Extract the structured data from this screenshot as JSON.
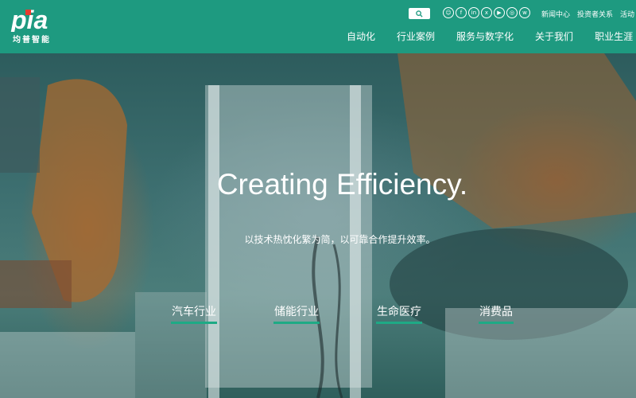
{
  "brand": {
    "logo_text": "pia",
    "logo_sub": "均普智能",
    "accent_color": "#1e9a80"
  },
  "search": {
    "icon": "search-icon"
  },
  "social_links": [
    {
      "name": "wechat",
      "glyph": "☺"
    },
    {
      "name": "facebook",
      "glyph": "f"
    },
    {
      "name": "linkedin",
      "glyph": "in"
    },
    {
      "name": "xing",
      "glyph": "x"
    },
    {
      "name": "youtube",
      "glyph": "▶"
    },
    {
      "name": "instagram",
      "glyph": "◎"
    },
    {
      "name": "weibo",
      "glyph": "w"
    }
  ],
  "top_links": [
    "新闻中心",
    "投资者关系",
    "活动"
  ],
  "main_nav": [
    "自动化",
    "行业案例",
    "服务与数字化",
    "关于我们",
    "职业生涯"
  ],
  "hero": {
    "title": "Creating Efficiency.",
    "subtitle": "以技术热忱化繁为简，以可靠合作提升效率。"
  },
  "industries": [
    "汽车行业",
    "储能行业",
    "生命医疗",
    "消费品"
  ]
}
